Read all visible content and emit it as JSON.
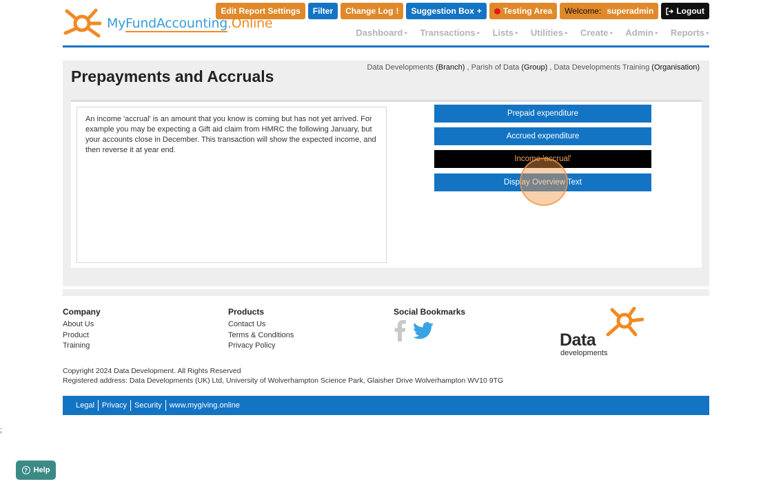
{
  "header": {
    "logo": {
      "part_my": "My",
      "part_fund": "FundAccounting",
      "part_online": ".Online"
    },
    "top_buttons": {
      "edit_report_settings": "Edit Report Settings",
      "filter": "Filter",
      "change_log": "Change Log",
      "change_log_mark": "!",
      "suggestion_box": "Suggestion Box",
      "suggestion_icon": "+",
      "testing_area": "Testing Area",
      "welcome": "Welcome:",
      "username": "superadmin",
      "logout": "Logout"
    },
    "nav": [
      {
        "label": "Dashboard"
      },
      {
        "label": "Transactions"
      },
      {
        "label": "Lists"
      },
      {
        "label": "Utilities"
      },
      {
        "label": "Create"
      },
      {
        "label": "Admin"
      },
      {
        "label": "Reports"
      }
    ],
    "colors": {
      "brand_blue": "#1474c4",
      "brand_orange": "#e0892a"
    }
  },
  "page": {
    "title": "Prepayments and Accruals",
    "breadcrumb": {
      "branch_name": "Data Developments",
      "branch_type": "(Branch)",
      "group_name": "Parish of Data",
      "group_type": "(Group)",
      "org_name": "Data Developments Training",
      "org_type": "(Organisation)",
      "sep": ","
    },
    "description": "An income 'accrual' is an amount that you know is coming but has not yet arrived. For example you may be expecting a Gift aid claim from HMRC the following January, but your accounts close in December. This transaction will show the expected income, and then reverse it at year end.",
    "actions": [
      {
        "label": "Prepaid expenditure",
        "active": false
      },
      {
        "label": "Accrued expenditure",
        "active": false
      },
      {
        "label": "Income 'accrual'",
        "active": true
      },
      {
        "label": "Display Overview Text",
        "active": false
      }
    ]
  },
  "footer": {
    "company": {
      "heading": "Company",
      "links": [
        "About Us",
        "Product",
        "Training"
      ]
    },
    "products": {
      "heading": "Products",
      "links": [
        "Contact Us",
        "Terms & Conditions",
        "Privacy Policy"
      ]
    },
    "social": {
      "heading": "Social Bookmarks",
      "icons": [
        "facebook-icon",
        "twitter-icon"
      ]
    },
    "brand": {
      "word": "Data",
      "sub": "developments"
    },
    "copyright": "Copyright 2024 Data Development. All Rights Reserved",
    "address": "Registered address: Data Developments (UK) Ltd, University of Wolverhampton Science Park, Glaisher Drive Wolverhampton WV10 9TG",
    "bar_links": [
      "Legal",
      "Privacy",
      "Security",
      "www.mygiving.online"
    ]
  },
  "stray_text": ";",
  "help": {
    "label": "Help"
  }
}
